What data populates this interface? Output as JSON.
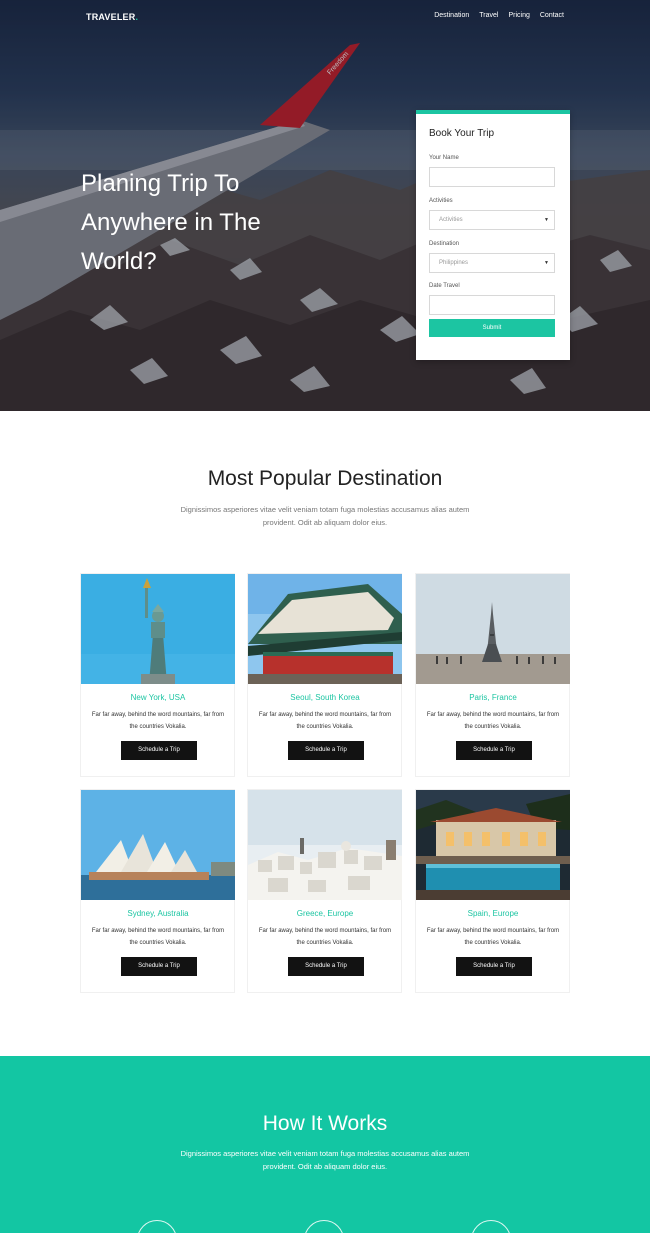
{
  "nav": {
    "brand": "TRAVELER",
    "brand_dot": ".",
    "links": [
      "Destination",
      "Travel",
      "Pricing",
      "Contact"
    ]
  },
  "hero": {
    "title": "Planing Trip To Anywhere in The World?",
    "wing_text": "Freedom"
  },
  "booking": {
    "title": "Book Your Trip",
    "name_label": "Your Name",
    "name_value": "",
    "activities_label": "Activities",
    "activities_value": "Activities",
    "destination_label": "Destination",
    "destination_value": "Philippines",
    "date_label": "Date Travel",
    "date_value": "",
    "submit_label": "Submit"
  },
  "popular": {
    "title": "Most Popular Destination",
    "subtitle": "Dignissimos asperiores vitae velit veniam totam fuga molestias accusamus alias autem provident. Odit ab aliquam dolor eius.",
    "cards": [
      {
        "title": "New York, USA",
        "desc": "Far far away, behind the word mountains, far from the countries Vokalia.",
        "button": "Schedule a Trip",
        "image": "statue-of-liberty"
      },
      {
        "title": "Seoul, South Korea",
        "desc": "Far far away, behind the word mountains, far from the countries Vokalia.",
        "button": "Schedule a Trip",
        "image": "korean-palace"
      },
      {
        "title": "Paris, France",
        "desc": "Far far away, behind the word mountains, far from the countries Vokalia.",
        "button": "Schedule a Trip",
        "image": "eiffel-tower"
      },
      {
        "title": "Sydney, Australia",
        "desc": "Far far away, behind the word mountains, far from the countries Vokalia.",
        "button": "Schedule a Trip",
        "image": "sydney-opera-house"
      },
      {
        "title": "Greece, Europe",
        "desc": "Far far away, behind the word mountains, far from the countries Vokalia.",
        "button": "Schedule a Trip",
        "image": "santorini-village"
      },
      {
        "title": "Spain, Europe",
        "desc": "Far far away, behind the word mountains, far from the countries Vokalia.",
        "button": "Schedule a Trip",
        "image": "spanish-villa-pool"
      }
    ]
  },
  "how": {
    "title": "How It Works",
    "subtitle": "Dignissimos asperiores vitae velit veniam totam fuga molestias accusamus alias autem provident. Odit ab aliquam dolor eius."
  },
  "colors": {
    "accent": "#1cc5a2",
    "how_background": "#13c6a3",
    "button_dark": "#121212"
  }
}
